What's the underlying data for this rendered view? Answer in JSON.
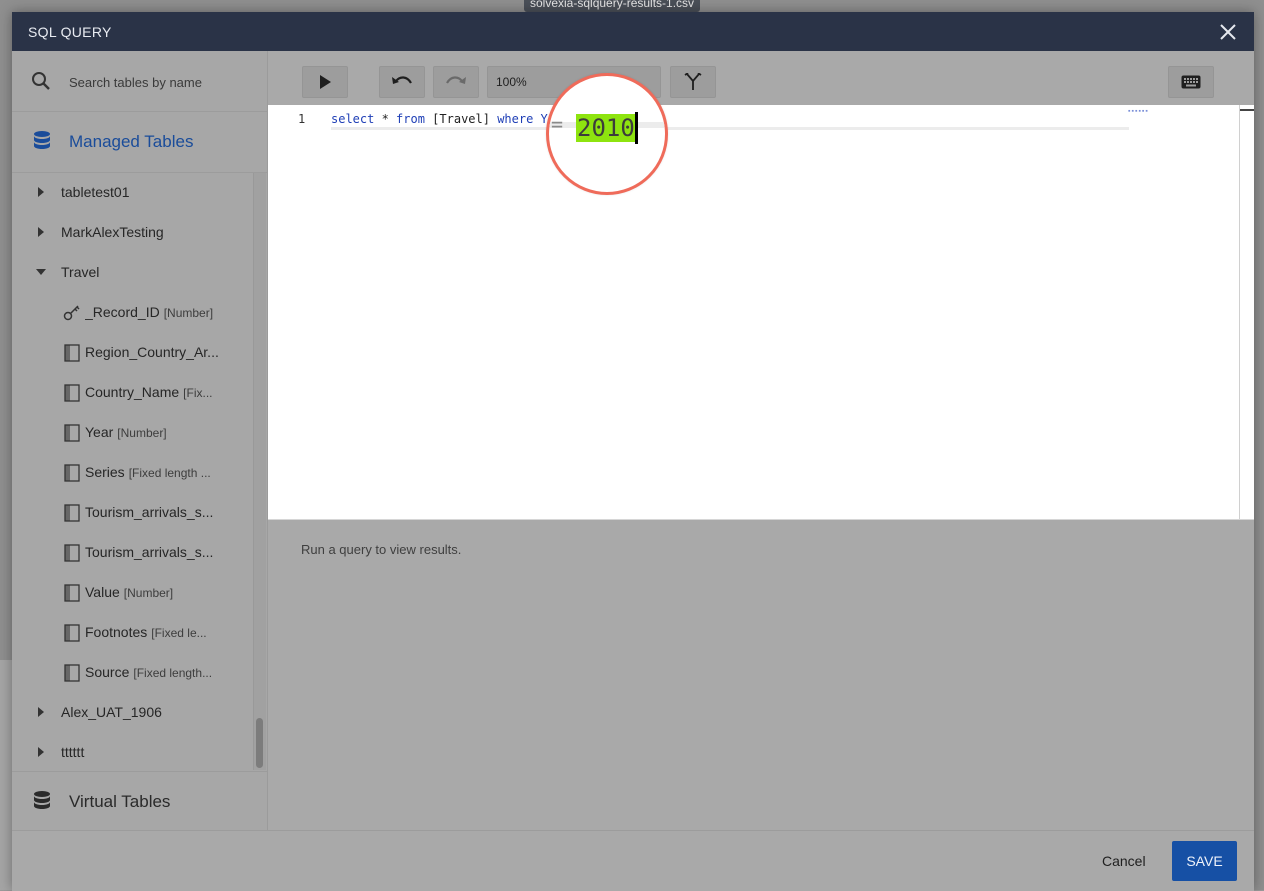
{
  "background": {
    "file_tab": "solvexia-sqlquery-results-1.csv"
  },
  "modal": {
    "title": "SQL QUERY"
  },
  "sidebar": {
    "search_placeholder": "Search tables by name",
    "managed_label": "Managed Tables",
    "virtual_label": "Virtual Tables",
    "tables": [
      {
        "name": "tabletest01",
        "expanded": false
      },
      {
        "name": "MarkAlexTesting",
        "expanded": false
      },
      {
        "name": "Travel",
        "expanded": true
      },
      {
        "name": "Alex_UAT_1906",
        "expanded": false
      },
      {
        "name": "tttttt",
        "expanded": false
      }
    ],
    "travel_columns": [
      {
        "name": "_Record_ID",
        "type": "[Number]",
        "icon": "key-icon"
      },
      {
        "name": "Region_Country_Ar...",
        "type": "",
        "icon": "column-icon"
      },
      {
        "name": "Country_Name",
        "type": "[Fix...",
        "icon": "column-icon"
      },
      {
        "name": "Year",
        "type": "[Number]",
        "icon": "column-icon"
      },
      {
        "name": "Series",
        "type": "[Fixed length ...",
        "icon": "column-icon"
      },
      {
        "name": "Tourism_arrivals_s...",
        "type": "",
        "icon": "column-icon"
      },
      {
        "name": "Tourism_arrivals_s...",
        "type": "",
        "icon": "column-icon"
      },
      {
        "name": "Value",
        "type": "[Number]",
        "icon": "column-icon"
      },
      {
        "name": "Footnotes",
        "type": "[Fixed le...",
        "icon": "column-icon"
      },
      {
        "name": "Source",
        "type": "[Fixed length...",
        "icon": "column-icon"
      }
    ]
  },
  "toolbar": {
    "zoom": "100%"
  },
  "editor": {
    "line_number": "1",
    "tokens": {
      "select": "select",
      "star": " * ",
      "from": "from",
      "table": " [Travel] ",
      "where": "where",
      "column": " Y"
    },
    "magnified_eq": "=",
    "magnified_value": "2010"
  },
  "results": {
    "empty_text": "Run a query to view results."
  },
  "footer": {
    "cancel_label": "Cancel",
    "save_label": "SAVE"
  },
  "colors": {
    "header_bg": "#2a3347",
    "accent": "#1650a5",
    "highlight": "#8ee40f",
    "magnifier_ring": "#ef6b5a"
  }
}
